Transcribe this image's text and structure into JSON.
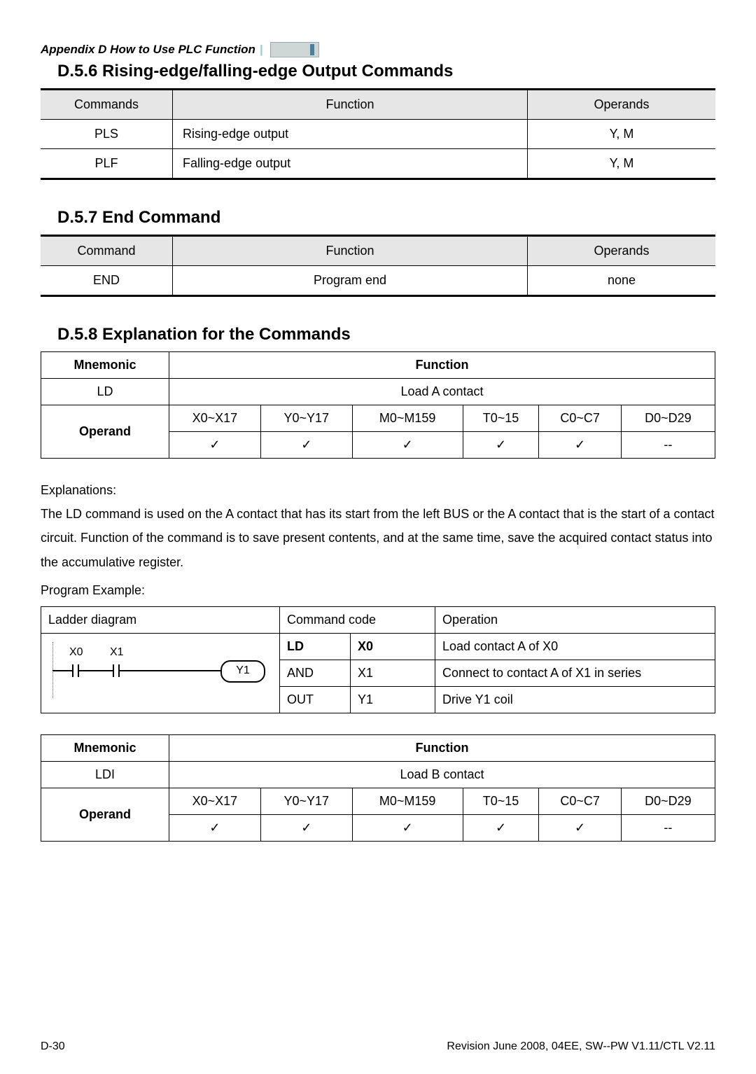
{
  "header": {
    "appendix": "Appendix D How to Use PLC Function"
  },
  "section_d56": {
    "title": "D.5.6 Rising-edge/falling-edge Output Commands",
    "headers": {
      "c1": "Commands",
      "c2": "Function",
      "c3": "Operands"
    },
    "rows": [
      {
        "cmd": "PLS",
        "fn": "Rising-edge output",
        "op": "Y, M"
      },
      {
        "cmd": "PLF",
        "fn": "Falling-edge output",
        "op": "Y, M"
      }
    ]
  },
  "section_d57": {
    "title": "D.5.7 End Command",
    "headers": {
      "c1": "Command",
      "c2": "Function",
      "c3": "Operands"
    },
    "rows": [
      {
        "cmd": "END",
        "fn": "Program end",
        "op": "none"
      }
    ]
  },
  "section_d58": {
    "title": "D.5.8 Explanation for the Commands"
  },
  "ld_table": {
    "mnemonic_label": "Mnemonic",
    "function_label": "Function",
    "mnemonic": "LD",
    "function": "Load A contact",
    "operand_label": "Operand",
    "ranges": [
      "X0~X17",
      "Y0~Y17",
      "M0~M159",
      "T0~15",
      "C0~C7",
      "D0~D29"
    ],
    "checks": [
      "✓",
      "✓",
      "✓",
      "✓",
      "✓",
      "--"
    ]
  },
  "explanations": {
    "label": "Explanations:",
    "text": "The LD command is used on the A contact that has its start from the left BUS or the A contact that is the start of a contact circuit. Function of the command is to save present contents, and at the same time, save the acquired contact status into the accumulative register."
  },
  "program_example": {
    "label": "Program Example:",
    "headers": {
      "ladder": "Ladder diagram",
      "cc": "Command code",
      "op": "Operation"
    },
    "ladder_labels": {
      "x0": "X0",
      "x1": "X1",
      "y1": "Y1"
    },
    "rows": [
      {
        "code": "LD",
        "arg": "X0",
        "op": "Load contact A of X0",
        "bold": true
      },
      {
        "code": "AND",
        "arg": "X1",
        "op": "Connect to contact A of X1 in series",
        "bold": false
      },
      {
        "code": "OUT",
        "arg": "Y1",
        "op": "Drive Y1 coil",
        "bold": false
      }
    ]
  },
  "ldi_table": {
    "mnemonic_label": "Mnemonic",
    "function_label": "Function",
    "mnemonic": "LDI",
    "function": "Load B contact",
    "operand_label": "Operand",
    "ranges": [
      "X0~X17",
      "Y0~Y17",
      "M0~M159",
      "T0~15",
      "C0~C7",
      "D0~D29"
    ],
    "checks": [
      "✓",
      "✓",
      "✓",
      "✓",
      "✓",
      "--"
    ]
  },
  "footer": {
    "left": "D-30",
    "right": "Revision June 2008, 04EE, SW--PW V1.11/CTL V2.11"
  }
}
